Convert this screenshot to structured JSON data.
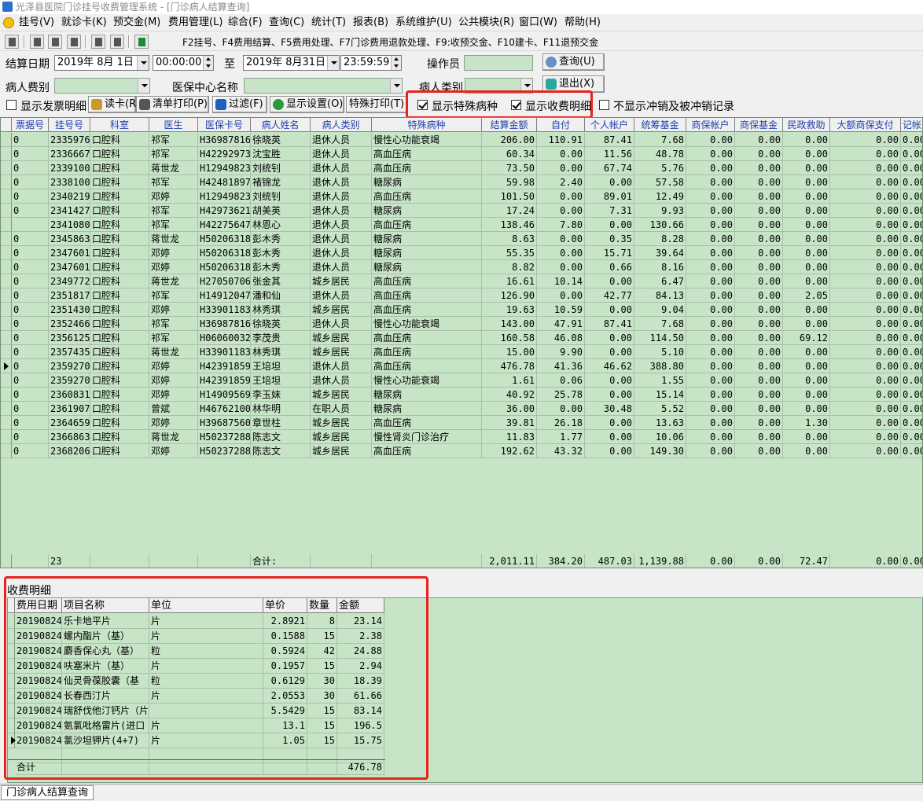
{
  "window": {
    "title": "光泽县医院门诊挂号收费管理系统 - [门诊病人结算查询]"
  },
  "menu": [
    "挂号(V)",
    "就诊卡(K)",
    "预交金(M)",
    "费用管理(L)",
    "综合(F)",
    "查询(C)",
    "统计(T)",
    "报表(B)",
    "系统维护(U)",
    "公共模块(R)",
    "窗口(W)",
    "帮助(H)"
  ],
  "hotkeys": "F2挂号、F4费用结算、F5费用处理、F7门诊费用退款处理、F9:收预交金、F10建卡、F11退预交金",
  "filters": {
    "date_label": "结算日期",
    "date_from": "2019年 8月 1日",
    "time_from": "00:00:00",
    "to_label": "至",
    "date_to": "2019年 8月31日",
    "time_to": "23:59:59",
    "operator_label": "操作员",
    "query_button": "查询(U)",
    "patient_fee_label": "病人费别",
    "insurance_center_label": "医保中心名称",
    "patient_type_label": "病人类别",
    "exit_button": "退出(X)"
  },
  "options": {
    "show_invoice_detail": "显示发票明细",
    "read_card": "读卡(R)",
    "print_list": "清单打印(P)",
    "filter": "过滤(F)",
    "display_settings": "显示设置(O)",
    "special_print": "特殊打印(T)",
    "show_special_disease": "显示特殊病种",
    "show_fee_detail": "显示收费明细",
    "hide_reversal": "不显示冲销及被冲销记录"
  },
  "grid": {
    "columns": [
      "票据号",
      "挂号号",
      "科室",
      "医生",
      "医保卡号",
      "病人姓名",
      "病人类别",
      "特殊病种",
      "结算金额",
      "自付",
      "个人帐户",
      "统筹基金",
      "商保帐户",
      "商保基金",
      "民政救助",
      "大额商保支付",
      "记帐"
    ],
    "rows": [
      [
        "0",
        "2335976",
        "口腔科",
        "祁军",
        "H36987816",
        "徐晓英",
        "退休人员",
        "慢性心功能衰竭",
        "206.00",
        "110.91",
        "87.41",
        "7.68",
        "0.00",
        "0.00",
        "0.00",
        "0.00",
        "0.00"
      ],
      [
        "0",
        "2336667",
        "口腔科",
        "祁军",
        "H42292973",
        "沈宝胜",
        "退休人员",
        "高血压病",
        "60.34",
        "0.00",
        "11.56",
        "48.78",
        "0.00",
        "0.00",
        "0.00",
        "0.00",
        "0.00"
      ],
      [
        "0",
        "2339100",
        "口腔科",
        "蒋世龙",
        "H12949823",
        "刘统钊",
        "退休人员",
        "高血压病",
        "73.50",
        "0.00",
        "67.74",
        "5.76",
        "0.00",
        "0.00",
        "0.00",
        "0.00",
        "0.00"
      ],
      [
        "0",
        "2338100",
        "口腔科",
        "祁军",
        "H42481897",
        "褚锦龙",
        "退休人员",
        "糖尿病",
        "59.98",
        "2.40",
        "0.00",
        "57.58",
        "0.00",
        "0.00",
        "0.00",
        "0.00",
        "0.00"
      ],
      [
        "0",
        "2340219",
        "口腔科",
        "邓婷",
        "H12949823",
        "刘统钊",
        "退休人员",
        "高血压病",
        "101.50",
        "0.00",
        "89.01",
        "12.49",
        "0.00",
        "0.00",
        "0.00",
        "0.00",
        "0.00"
      ],
      [
        "0",
        "2341427",
        "口腔科",
        "祁军",
        "H42973621",
        "胡美英",
        "退休人员",
        "糖尿病",
        "17.24",
        "0.00",
        "7.31",
        "9.93",
        "0.00",
        "0.00",
        "0.00",
        "0.00",
        "0.00"
      ],
      [
        "",
        "2341080",
        "口腔科",
        "祁军",
        "H42275647",
        "林恩心",
        "退休人员",
        "高血压病",
        "138.46",
        "7.80",
        "0.00",
        "130.66",
        "0.00",
        "0.00",
        "0.00",
        "0.00",
        "0.00"
      ],
      [
        "0",
        "2345863",
        "口腔科",
        "蒋世龙",
        "H50206318",
        "彭木秀",
        "退休人员",
        "糖尿病",
        "8.63",
        "0.00",
        "0.35",
        "8.28",
        "0.00",
        "0.00",
        "0.00",
        "0.00",
        "0.00"
      ],
      [
        "0",
        "2347601",
        "口腔科",
        "邓婷",
        "H50206318",
        "彭木秀",
        "退休人员",
        "糖尿病",
        "55.35",
        "0.00",
        "15.71",
        "39.64",
        "0.00",
        "0.00",
        "0.00",
        "0.00",
        "0.00"
      ],
      [
        "0",
        "2347601",
        "口腔科",
        "邓婷",
        "H50206318",
        "彭木秀",
        "退休人员",
        "糖尿病",
        "8.82",
        "0.00",
        "0.66",
        "8.16",
        "0.00",
        "0.00",
        "0.00",
        "0.00",
        "0.00"
      ],
      [
        "0",
        "2349772",
        "口腔科",
        "蒋世龙",
        "H27050706",
        "张金其",
        "城乡居民",
        "高血压病",
        "16.61",
        "10.14",
        "0.00",
        "6.47",
        "0.00",
        "0.00",
        "0.00",
        "0.00",
        "0.00"
      ],
      [
        "0",
        "2351817",
        "口腔科",
        "祁军",
        "H14912047",
        "潘和仙",
        "退休人员",
        "高血压病",
        "126.90",
        "0.00",
        "42.77",
        "84.13",
        "0.00",
        "0.00",
        "2.05",
        "0.00",
        "0.00"
      ],
      [
        "0",
        "2351430",
        "口腔科",
        "邓婷",
        "H33901183",
        "林秀琪",
        "城乡居民",
        "高血压病",
        "19.63",
        "10.59",
        "0.00",
        "9.04",
        "0.00",
        "0.00",
        "0.00",
        "0.00",
        "0.00"
      ],
      [
        "0",
        "2352466",
        "口腔科",
        "祁军",
        "H36987816",
        "徐晓英",
        "退休人员",
        "慢性心功能衰竭",
        "143.00",
        "47.91",
        "87.41",
        "7.68",
        "0.00",
        "0.00",
        "0.00",
        "0.00",
        "0.00"
      ],
      [
        "0",
        "2356125",
        "口腔科",
        "祁军",
        "H06060032",
        "李茂贵",
        "城乡居民",
        "高血压病",
        "160.58",
        "46.08",
        "0.00",
        "114.50",
        "0.00",
        "0.00",
        "69.12",
        "0.00",
        "0.00"
      ],
      [
        "0",
        "2357435",
        "口腔科",
        "蒋世龙",
        "H33901183",
        "林秀琪",
        "城乡居民",
        "高血压病",
        "15.00",
        "9.90",
        "0.00",
        "5.10",
        "0.00",
        "0.00",
        "0.00",
        "0.00",
        "0.00"
      ],
      [
        "0",
        "2359270",
        "口腔科",
        "邓婷",
        "H42391859",
        "王培坦",
        "退休人员",
        "高血压病",
        "476.78",
        "41.36",
        "46.62",
        "388.80",
        "0.00",
        "0.00",
        "0.00",
        "0.00",
        "0.00"
      ],
      [
        "0",
        "2359270",
        "口腔科",
        "邓婷",
        "H42391859",
        "王培坦",
        "退休人员",
        "慢性心功能衰竭",
        "1.61",
        "0.06",
        "0.00",
        "1.55",
        "0.00",
        "0.00",
        "0.00",
        "0.00",
        "0.00"
      ],
      [
        "0",
        "2360831",
        "口腔科",
        "邓婷",
        "H14909569",
        "李玉妹",
        "城乡居民",
        "糖尿病",
        "40.92",
        "25.78",
        "0.00",
        "15.14",
        "0.00",
        "0.00",
        "0.00",
        "0.00",
        "0.00"
      ],
      [
        "0",
        "2361907",
        "口腔科",
        "曾斌",
        "H46762100",
        "林华明",
        "在职人员",
        "糖尿病",
        "36.00",
        "0.00",
        "30.48",
        "5.52",
        "0.00",
        "0.00",
        "0.00",
        "0.00",
        "0.00"
      ],
      [
        "0",
        "2364659",
        "口腔科",
        "邓婷",
        "H39687560",
        "章世柱",
        "城乡居民",
        "高血压病",
        "39.81",
        "26.18",
        "0.00",
        "13.63",
        "0.00",
        "0.00",
        "1.30",
        "0.00",
        "0.00"
      ],
      [
        "0",
        "2366863",
        "口腔科",
        "蒋世龙",
        "H50237288",
        "陈志文",
        "城乡居民",
        "慢性肾炎门诊治疗",
        "11.83",
        "1.77",
        "0.00",
        "10.06",
        "0.00",
        "0.00",
        "0.00",
        "0.00",
        "0.00"
      ],
      [
        "0",
        "2368206",
        "口腔科",
        "邓婷",
        "H50237288",
        "陈志文",
        "城乡居民",
        "高血压病",
        "192.62",
        "43.32",
        "0.00",
        "149.30",
        "0.00",
        "0.00",
        "0.00",
        "0.00",
        "0.00"
      ]
    ],
    "summary": {
      "count": "23",
      "label": "合计:",
      "total": "2,011.11",
      "self_pay": "384.20",
      "personal_account": "487.03",
      "pooled_fund": "1,139.88",
      "commercial_account": "0.00",
      "commercial_fund": "0.00",
      "civil_aid": "72.47",
      "large_commercial": "0.00",
      "ledger": "0.00"
    }
  },
  "detail": {
    "legend": "收费明细",
    "columns": [
      "费用日期",
      "项目名称",
      "单位",
      "单价",
      "数量",
      "金额"
    ],
    "rows": [
      [
        "20190824",
        "乐卡地平片",
        "片",
        "2.8921",
        "8",
        "23.14"
      ],
      [
        "20190824",
        "螺内酯片（基）",
        "片",
        "0.1588",
        "15",
        "2.38"
      ],
      [
        "20190824",
        "麝香保心丸（基）",
        "粒",
        "0.5924",
        "42",
        "24.88"
      ],
      [
        "20190824",
        "呋塞米片（基）",
        "片",
        "0.1957",
        "15",
        "2.94"
      ],
      [
        "20190824",
        "仙灵骨葆胶囊（基",
        "粒",
        "0.6129",
        "30",
        "18.39"
      ],
      [
        "20190824",
        "长春西汀片",
        "片",
        "2.0553",
        "30",
        "61.66"
      ],
      [
        "20190824",
        "瑞舒伐他汀钙片（片",
        "",
        "5.5429",
        "15",
        "83.14"
      ],
      [
        "20190824",
        "氨氯吡格雷片(进口",
        "片",
        "13.1",
        "15",
        "196.5"
      ],
      [
        "20190824",
        "氯沙坦钾片(4+7)",
        "片",
        "1.05",
        "15",
        "15.75"
      ]
    ],
    "total_label": "合计",
    "total": "476.78"
  },
  "statusbar": {
    "tab": "门诊病人结算查询"
  }
}
